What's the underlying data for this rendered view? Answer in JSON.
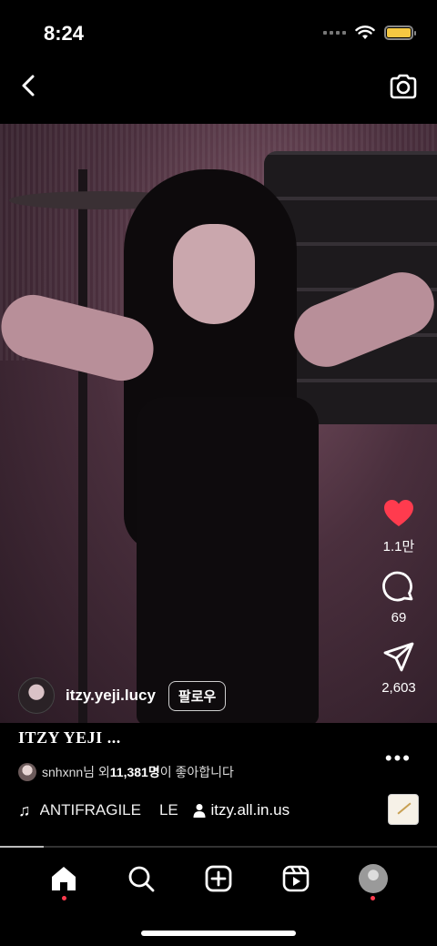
{
  "status_bar": {
    "time": "8:24",
    "battery_level": 1.0,
    "battery_color": "#f5c842"
  },
  "top_bar": {
    "back_icon": "chevron-left-icon",
    "camera_icon": "camera-icon"
  },
  "reel": {
    "author": {
      "username": "itzy.yeji.lucy",
      "follow_label": "팔로우"
    },
    "caption": "ITZY YEJI ...",
    "actions": {
      "like_count": "1.1만",
      "comment_count": "69",
      "share_count": "2,603",
      "liked": true,
      "like_color": "#ff3b4e"
    },
    "liked_by": {
      "prefix": "snhxnn님 외 ",
      "count": "11,381명",
      "suffix": "이 좋아합니다"
    },
    "audio": {
      "track": "ANTIFRAGILE",
      "track_tail": "LE",
      "tagged_user": "itzy.all.in.us"
    },
    "progress": 0.1
  },
  "tab_bar": {
    "items": [
      "home-icon",
      "search-icon",
      "create-icon",
      "reels-icon",
      "profile-avatar"
    ],
    "active": "home",
    "dot_color": "#ff3b4e"
  }
}
